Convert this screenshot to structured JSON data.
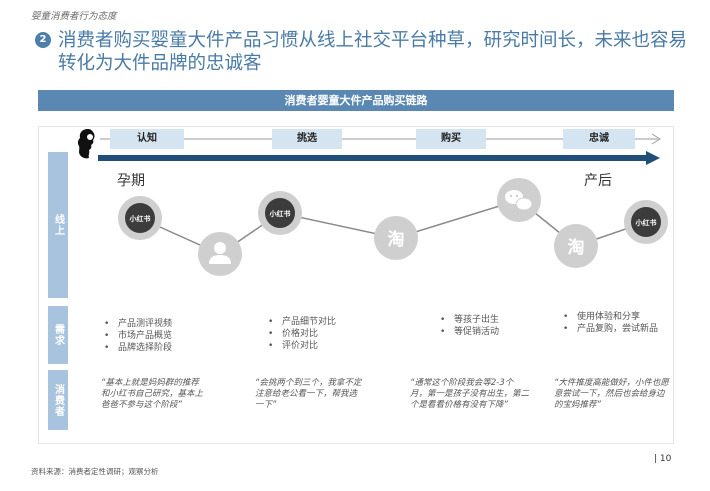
{
  "section_label": "婴童消费者行为态度",
  "headline": {
    "number": "2",
    "text": "消费者购买婴童大件产品习惯从线上社交平台种草，研究时间长，未来也容易转化为大件品牌的忠诚客"
  },
  "banner": "消费者婴童大件产品购买链路",
  "stages": [
    "认知",
    "挑选",
    "购买",
    "忠诚"
  ],
  "timeline": {
    "start": "孕期",
    "end": "产后"
  },
  "rows": {
    "online": "线上",
    "needs": "需求",
    "consumer": "消费者"
  },
  "icons": [
    {
      "name": "xiaohongshu",
      "label": "小红书"
    },
    {
      "name": "person",
      "label": ""
    },
    {
      "name": "xiaohongshu",
      "label": "小红书"
    },
    {
      "name": "taobao",
      "label": "淘"
    },
    {
      "name": "wechat",
      "label": ""
    },
    {
      "name": "taobao",
      "label": "淘"
    },
    {
      "name": "xiaohongshu",
      "label": "小红书"
    }
  ],
  "needs": [
    [
      "产品测评视频",
      "市场产品概览",
      "品牌选择阶段"
    ],
    [
      "产品细节对比",
      "价格对比",
      "评价对比"
    ],
    [
      "等孩子出生",
      "等促销活动"
    ],
    [
      "使用体验和分享",
      "产品复购，尝试新品"
    ]
  ],
  "quotes": [
    "“基本上就是妈妈群的推荐和小红书自己研究，基本上爸爸不参与这个阶段”",
    "“会挑两个到三个，我拿不定注意给老公看一下，帮我选一下”",
    "“通常这个阶段我会等2-3个月，第一是孩子没有出生，第二个是看看价格有没有下降”",
    "“大件推度高能做好，小件也愿意尝试一下，然后也会给身边的宝妈推荐”"
  ],
  "source": "资料来源：消费者定性调研；观察分析",
  "page": "| 10",
  "colors": {
    "accent": "#4a7ba6",
    "navy": "#1f4e79",
    "light": "#d5e4f1",
    "side": "#a8c3dd",
    "icon": "#cfcfcf"
  }
}
